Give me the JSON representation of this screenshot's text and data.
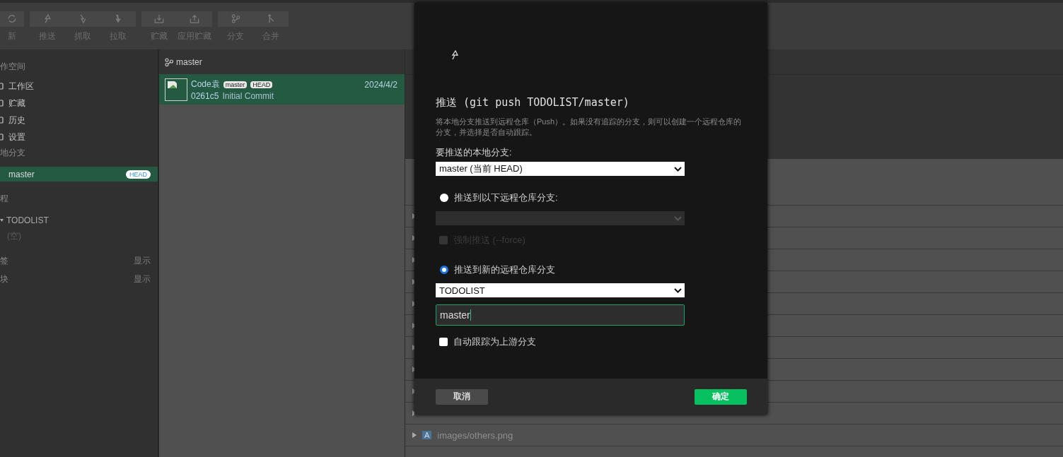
{
  "toolbar": {
    "groups": [
      [
        {
          "label": "新"
        }
      ],
      [
        {
          "label": "推送"
        },
        {
          "label": "抓取"
        },
        {
          "label": "拉取"
        }
      ],
      [
        {
          "label": "贮藏"
        },
        {
          "label": "应用贮藏"
        }
      ],
      [
        {
          "label": "分支"
        },
        {
          "label": "合并"
        }
      ]
    ]
  },
  "sidebar": {
    "sections": [
      {
        "title": "作空间",
        "items": [
          {
            "label": "工作区"
          },
          {
            "label": "贮藏"
          },
          {
            "label": "历史"
          },
          {
            "label": "设置"
          }
        ]
      },
      {
        "title": "地分支",
        "branches": [
          {
            "name": "master",
            "badge": "HEAD",
            "selected": true
          }
        ]
      },
      {
        "title": "程",
        "remotes": [
          {
            "name": "TODOLIST",
            "expanded": true,
            "children": [
              {
                "label": "(空)"
              }
            ]
          }
        ]
      },
      {
        "title": "签",
        "action": "显示"
      },
      {
        "title": "块",
        "action": "显示"
      }
    ]
  },
  "history": {
    "branch": "master",
    "commits": [
      {
        "author": "Code袁",
        "refs": [
          "master",
          "HEAD"
        ],
        "date": "2024/4/2",
        "hash": "0261c5",
        "message": "Initial Commit",
        "selected": true
      }
    ]
  },
  "changes": {
    "files": [
      {
        "status": "A",
        "path": "images/others.png"
      }
    ]
  },
  "dialog": {
    "title": "推送 (git push TODOLIST/master)",
    "description": "将本地分支推送到远程仓库（Push）。如果没有追踪的分支，则可以创建一个远程仓库的分支，并选择是否自动跟踪。",
    "local_branch_label": "要推送的本地分支:",
    "local_branch": "master (当前 HEAD)",
    "options": [
      {
        "kind": "existing",
        "label": "推送到以下远程仓库分支:",
        "selected": false,
        "force_label": "强制推送 (--force)",
        "force_checked": false
      },
      {
        "kind": "new",
        "label": "推送到新的远程仓库分支",
        "selected": true,
        "remote": "TODOLIST",
        "branch_name": "master"
      }
    ],
    "track_label": "自动跟踪为上游分支",
    "track_checked": false,
    "buttons": [
      {
        "kind": "cancel",
        "label": "取消"
      },
      {
        "kind": "confirm",
        "label": "确定"
      }
    ]
  }
}
